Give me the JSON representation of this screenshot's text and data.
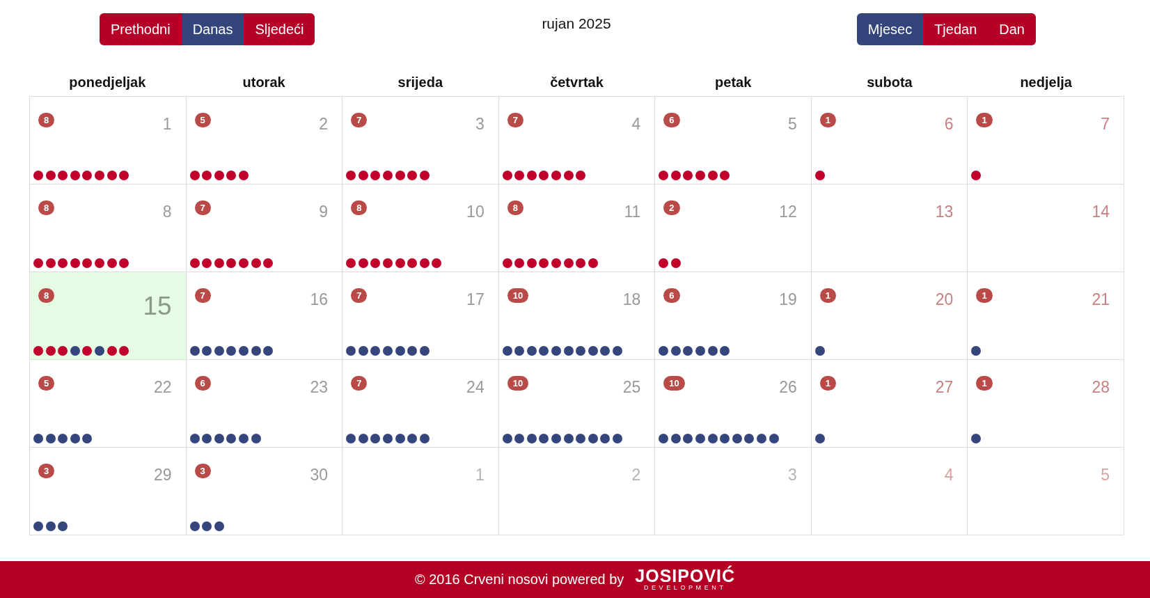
{
  "toolbar": {
    "nav_buttons": [
      {
        "label": "Prethodni",
        "active": false
      },
      {
        "label": "Danas",
        "active": true
      },
      {
        "label": "Sljedeći",
        "active": false
      }
    ],
    "title": "rujan 2025",
    "view_buttons": [
      {
        "label": "Mjesec",
        "selected": true
      },
      {
        "label": "Tjedan",
        "selected": false
      },
      {
        "label": "Dan",
        "selected": false
      }
    ]
  },
  "calendar": {
    "weekdays": [
      "ponedjeljak",
      "utorak",
      "srijeda",
      "četvrtak",
      "petak",
      "subota",
      "nedjelja"
    ],
    "weeks": [
      {
        "days": [
          {
            "date": "1",
            "weekend": false,
            "other_month": false,
            "today": false,
            "badge": "8",
            "events": [
              {
                "color": "#c1002b"
              },
              {
                "color": "#c1002b"
              },
              {
                "color": "#c1002b"
              },
              {
                "color": "#c1002b"
              },
              {
                "color": "#c1002b"
              },
              {
                "color": "#c1002b"
              },
              {
                "color": "#c1002b"
              },
              {
                "color": "#c1002b"
              }
            ]
          },
          {
            "date": "2",
            "weekend": false,
            "other_month": false,
            "today": false,
            "badge": "5",
            "events": [
              {
                "color": "#c1002b"
              },
              {
                "color": "#c1002b"
              },
              {
                "color": "#c1002b"
              },
              {
                "color": "#c1002b"
              },
              {
                "color": "#c1002b"
              }
            ]
          },
          {
            "date": "3",
            "weekend": false,
            "other_month": false,
            "today": false,
            "badge": "7",
            "events": [
              {
                "color": "#c1002b"
              },
              {
                "color": "#c1002b"
              },
              {
                "color": "#c1002b"
              },
              {
                "color": "#c1002b"
              },
              {
                "color": "#c1002b"
              },
              {
                "color": "#c1002b"
              },
              {
                "color": "#c1002b"
              }
            ]
          },
          {
            "date": "4",
            "weekend": false,
            "other_month": false,
            "today": false,
            "badge": "7",
            "events": [
              {
                "color": "#c1002b"
              },
              {
                "color": "#c1002b"
              },
              {
                "color": "#c1002b"
              },
              {
                "color": "#c1002b"
              },
              {
                "color": "#c1002b"
              },
              {
                "color": "#c1002b"
              },
              {
                "color": "#c1002b"
              }
            ]
          },
          {
            "date": "5",
            "weekend": false,
            "other_month": false,
            "today": false,
            "badge": "6",
            "events": [
              {
                "color": "#c1002b"
              },
              {
                "color": "#c1002b"
              },
              {
                "color": "#c1002b"
              },
              {
                "color": "#c1002b"
              },
              {
                "color": "#c1002b"
              },
              {
                "color": "#c1002b"
              }
            ]
          },
          {
            "date": "6",
            "weekend": true,
            "other_month": false,
            "today": false,
            "badge": "1",
            "events": [
              {
                "color": "#c1002b"
              }
            ]
          },
          {
            "date": "7",
            "weekend": true,
            "other_month": false,
            "today": false,
            "badge": "1",
            "events": [
              {
                "color": "#c1002b"
              }
            ]
          }
        ]
      },
      {
        "days": [
          {
            "date": "8",
            "weekend": false,
            "other_month": false,
            "today": false,
            "badge": "8",
            "events": [
              {
                "color": "#c1002b"
              },
              {
                "color": "#c1002b"
              },
              {
                "color": "#c1002b"
              },
              {
                "color": "#c1002b"
              },
              {
                "color": "#c1002b"
              },
              {
                "color": "#c1002b"
              },
              {
                "color": "#c1002b"
              },
              {
                "color": "#c1002b"
              }
            ]
          },
          {
            "date": "9",
            "weekend": false,
            "other_month": false,
            "today": false,
            "badge": "7",
            "events": [
              {
                "color": "#c1002b"
              },
              {
                "color": "#c1002b"
              },
              {
                "color": "#c1002b"
              },
              {
                "color": "#c1002b"
              },
              {
                "color": "#c1002b"
              },
              {
                "color": "#c1002b"
              },
              {
                "color": "#c1002b"
              }
            ]
          },
          {
            "date": "10",
            "weekend": false,
            "other_month": false,
            "today": false,
            "badge": "8",
            "events": [
              {
                "color": "#c1002b"
              },
              {
                "color": "#c1002b"
              },
              {
                "color": "#c1002b"
              },
              {
                "color": "#c1002b"
              },
              {
                "color": "#c1002b"
              },
              {
                "color": "#c1002b"
              },
              {
                "color": "#c1002b"
              },
              {
                "color": "#c1002b"
              }
            ]
          },
          {
            "date": "11",
            "weekend": false,
            "other_month": false,
            "today": false,
            "badge": "8",
            "events": [
              {
                "color": "#c1002b"
              },
              {
                "color": "#c1002b"
              },
              {
                "color": "#c1002b"
              },
              {
                "color": "#c1002b"
              },
              {
                "color": "#c1002b"
              },
              {
                "color": "#c1002b"
              },
              {
                "color": "#c1002b"
              },
              {
                "color": "#c1002b"
              }
            ]
          },
          {
            "date": "12",
            "weekend": false,
            "other_month": false,
            "today": false,
            "badge": "2",
            "events": [
              {
                "color": "#c1002b"
              },
              {
                "color": "#c1002b"
              }
            ]
          },
          {
            "date": "13",
            "weekend": true,
            "other_month": false,
            "today": false
          },
          {
            "date": "14",
            "weekend": true,
            "other_month": false,
            "today": false
          }
        ]
      },
      {
        "days": [
          {
            "date": "15",
            "weekend": false,
            "other_month": false,
            "today": true,
            "badge": "8",
            "events": [
              {
                "color": "#c1002b"
              },
              {
                "color": "#c1002b"
              },
              {
                "color": "#c1002b"
              },
              {
                "color": "#34467b"
              },
              {
                "color": "#c1002b"
              },
              {
                "color": "#34467b"
              },
              {
                "color": "#c1002b"
              },
              {
                "color": "#c1002b"
              }
            ]
          },
          {
            "date": "16",
            "weekend": false,
            "other_month": false,
            "today": false,
            "badge": "7",
            "events": [
              {
                "color": "#34467b"
              },
              {
                "color": "#34467b"
              },
              {
                "color": "#34467b"
              },
              {
                "color": "#34467b"
              },
              {
                "color": "#34467b"
              },
              {
                "color": "#34467b"
              },
              {
                "color": "#34467b"
              }
            ]
          },
          {
            "date": "17",
            "weekend": false,
            "other_month": false,
            "today": false,
            "badge": "7",
            "events": [
              {
                "color": "#34467b"
              },
              {
                "color": "#34467b"
              },
              {
                "color": "#34467b"
              },
              {
                "color": "#34467b"
              },
              {
                "color": "#34467b"
              },
              {
                "color": "#34467b"
              },
              {
                "color": "#34467b"
              }
            ]
          },
          {
            "date": "18",
            "weekend": false,
            "other_month": false,
            "today": false,
            "badge": "10",
            "events": [
              {
                "color": "#34467b"
              },
              {
                "color": "#34467b"
              },
              {
                "color": "#34467b"
              },
              {
                "color": "#34467b"
              },
              {
                "color": "#34467b"
              },
              {
                "color": "#34467b"
              },
              {
                "color": "#34467b"
              },
              {
                "color": "#34467b"
              },
              {
                "color": "#34467b"
              },
              {
                "color": "#34467b"
              }
            ]
          },
          {
            "date": "19",
            "weekend": false,
            "other_month": false,
            "today": false,
            "badge": "6",
            "events": [
              {
                "color": "#34467b"
              },
              {
                "color": "#34467b"
              },
              {
                "color": "#34467b"
              },
              {
                "color": "#34467b"
              },
              {
                "color": "#34467b"
              },
              {
                "color": "#34467b"
              }
            ]
          },
          {
            "date": "20",
            "weekend": true,
            "other_month": false,
            "today": false,
            "badge": "1",
            "events": [
              {
                "color": "#34467b"
              }
            ]
          },
          {
            "date": "21",
            "weekend": true,
            "other_month": false,
            "today": false,
            "badge": "1",
            "events": [
              {
                "color": "#34467b"
              }
            ]
          }
        ]
      },
      {
        "days": [
          {
            "date": "22",
            "weekend": false,
            "other_month": false,
            "today": false,
            "badge": "5",
            "events": [
              {
                "color": "#34467b"
              },
              {
                "color": "#34467b"
              },
              {
                "color": "#34467b"
              },
              {
                "color": "#34467b"
              },
              {
                "color": "#34467b"
              }
            ]
          },
          {
            "date": "23",
            "weekend": false,
            "other_month": false,
            "today": false,
            "badge": "6",
            "events": [
              {
                "color": "#34467b"
              },
              {
                "color": "#34467b"
              },
              {
                "color": "#34467b"
              },
              {
                "color": "#34467b"
              },
              {
                "color": "#34467b"
              },
              {
                "color": "#34467b"
              }
            ]
          },
          {
            "date": "24",
            "weekend": false,
            "other_month": false,
            "today": false,
            "badge": "7",
            "events": [
              {
                "color": "#34467b"
              },
              {
                "color": "#34467b"
              },
              {
                "color": "#34467b"
              },
              {
                "color": "#34467b"
              },
              {
                "color": "#34467b"
              },
              {
                "color": "#34467b"
              },
              {
                "color": "#34467b"
              }
            ]
          },
          {
            "date": "25",
            "weekend": false,
            "other_month": false,
            "today": false,
            "badge": "10",
            "events": [
              {
                "color": "#34467b"
              },
              {
                "color": "#34467b"
              },
              {
                "color": "#34467b"
              },
              {
                "color": "#34467b"
              },
              {
                "color": "#34467b"
              },
              {
                "color": "#34467b"
              },
              {
                "color": "#34467b"
              },
              {
                "color": "#34467b"
              },
              {
                "color": "#34467b"
              },
              {
                "color": "#34467b"
              }
            ]
          },
          {
            "date": "26",
            "weekend": false,
            "other_month": false,
            "today": false,
            "badge": "10",
            "events": [
              {
                "color": "#34467b"
              },
              {
                "color": "#34467b"
              },
              {
                "color": "#34467b"
              },
              {
                "color": "#34467b"
              },
              {
                "color": "#34467b"
              },
              {
                "color": "#34467b"
              },
              {
                "color": "#34467b"
              },
              {
                "color": "#34467b"
              },
              {
                "color": "#34467b"
              },
              {
                "color": "#34467b"
              }
            ]
          },
          {
            "date": "27",
            "weekend": true,
            "other_month": false,
            "today": false,
            "badge": "1",
            "events": [
              {
                "color": "#34467b"
              }
            ]
          },
          {
            "date": "28",
            "weekend": true,
            "other_month": false,
            "today": false,
            "badge": "1",
            "events": [
              {
                "color": "#34467b"
              }
            ]
          }
        ]
      },
      {
        "days": [
          {
            "date": "29",
            "weekend": false,
            "other_month": false,
            "today": false,
            "badge": "3",
            "events": [
              {
                "color": "#34467b"
              },
              {
                "color": "#34467b"
              },
              {
                "color": "#34467b"
              }
            ]
          },
          {
            "date": "30",
            "weekend": false,
            "other_month": false,
            "today": false,
            "badge": "3",
            "events": [
              {
                "color": "#34467b"
              },
              {
                "color": "#34467b"
              },
              {
                "color": "#34467b"
              }
            ]
          },
          {
            "date": "1",
            "weekend": false,
            "other_month": true,
            "today": false
          },
          {
            "date": "2",
            "weekend": false,
            "other_month": true,
            "today": false
          },
          {
            "date": "3",
            "weekend": false,
            "other_month": true,
            "today": false
          },
          {
            "date": "4",
            "weekend": true,
            "other_month": true,
            "today": false
          },
          {
            "date": "5",
            "weekend": true,
            "other_month": true,
            "today": false
          }
        ]
      }
    ]
  },
  "footer": {
    "text": "© 2016 Crveni nosovi powered by",
    "logo": {
      "wordmark": "JOSIPOVIĆ",
      "tagline": "DEVELOPMENT"
    }
  }
}
